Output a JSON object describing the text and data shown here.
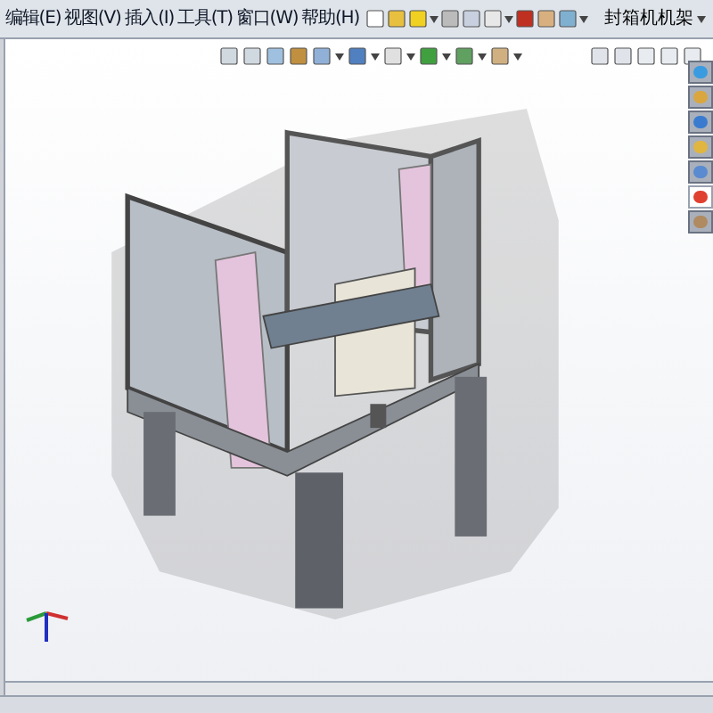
{
  "menu_bar": {
    "items": [
      "编辑(E)",
      "视图(V)",
      "插入(I)",
      "工具(T)",
      "窗口(W)",
      "帮助(H)"
    ]
  },
  "document_dropdown": {
    "value": "封箱机机架"
  },
  "task_pane_tabs": [
    {
      "selected": false
    },
    {
      "selected": false
    },
    {
      "selected": false
    },
    {
      "selected": false
    },
    {
      "selected": false
    },
    {
      "selected": true
    },
    {
      "selected": false
    }
  ]
}
